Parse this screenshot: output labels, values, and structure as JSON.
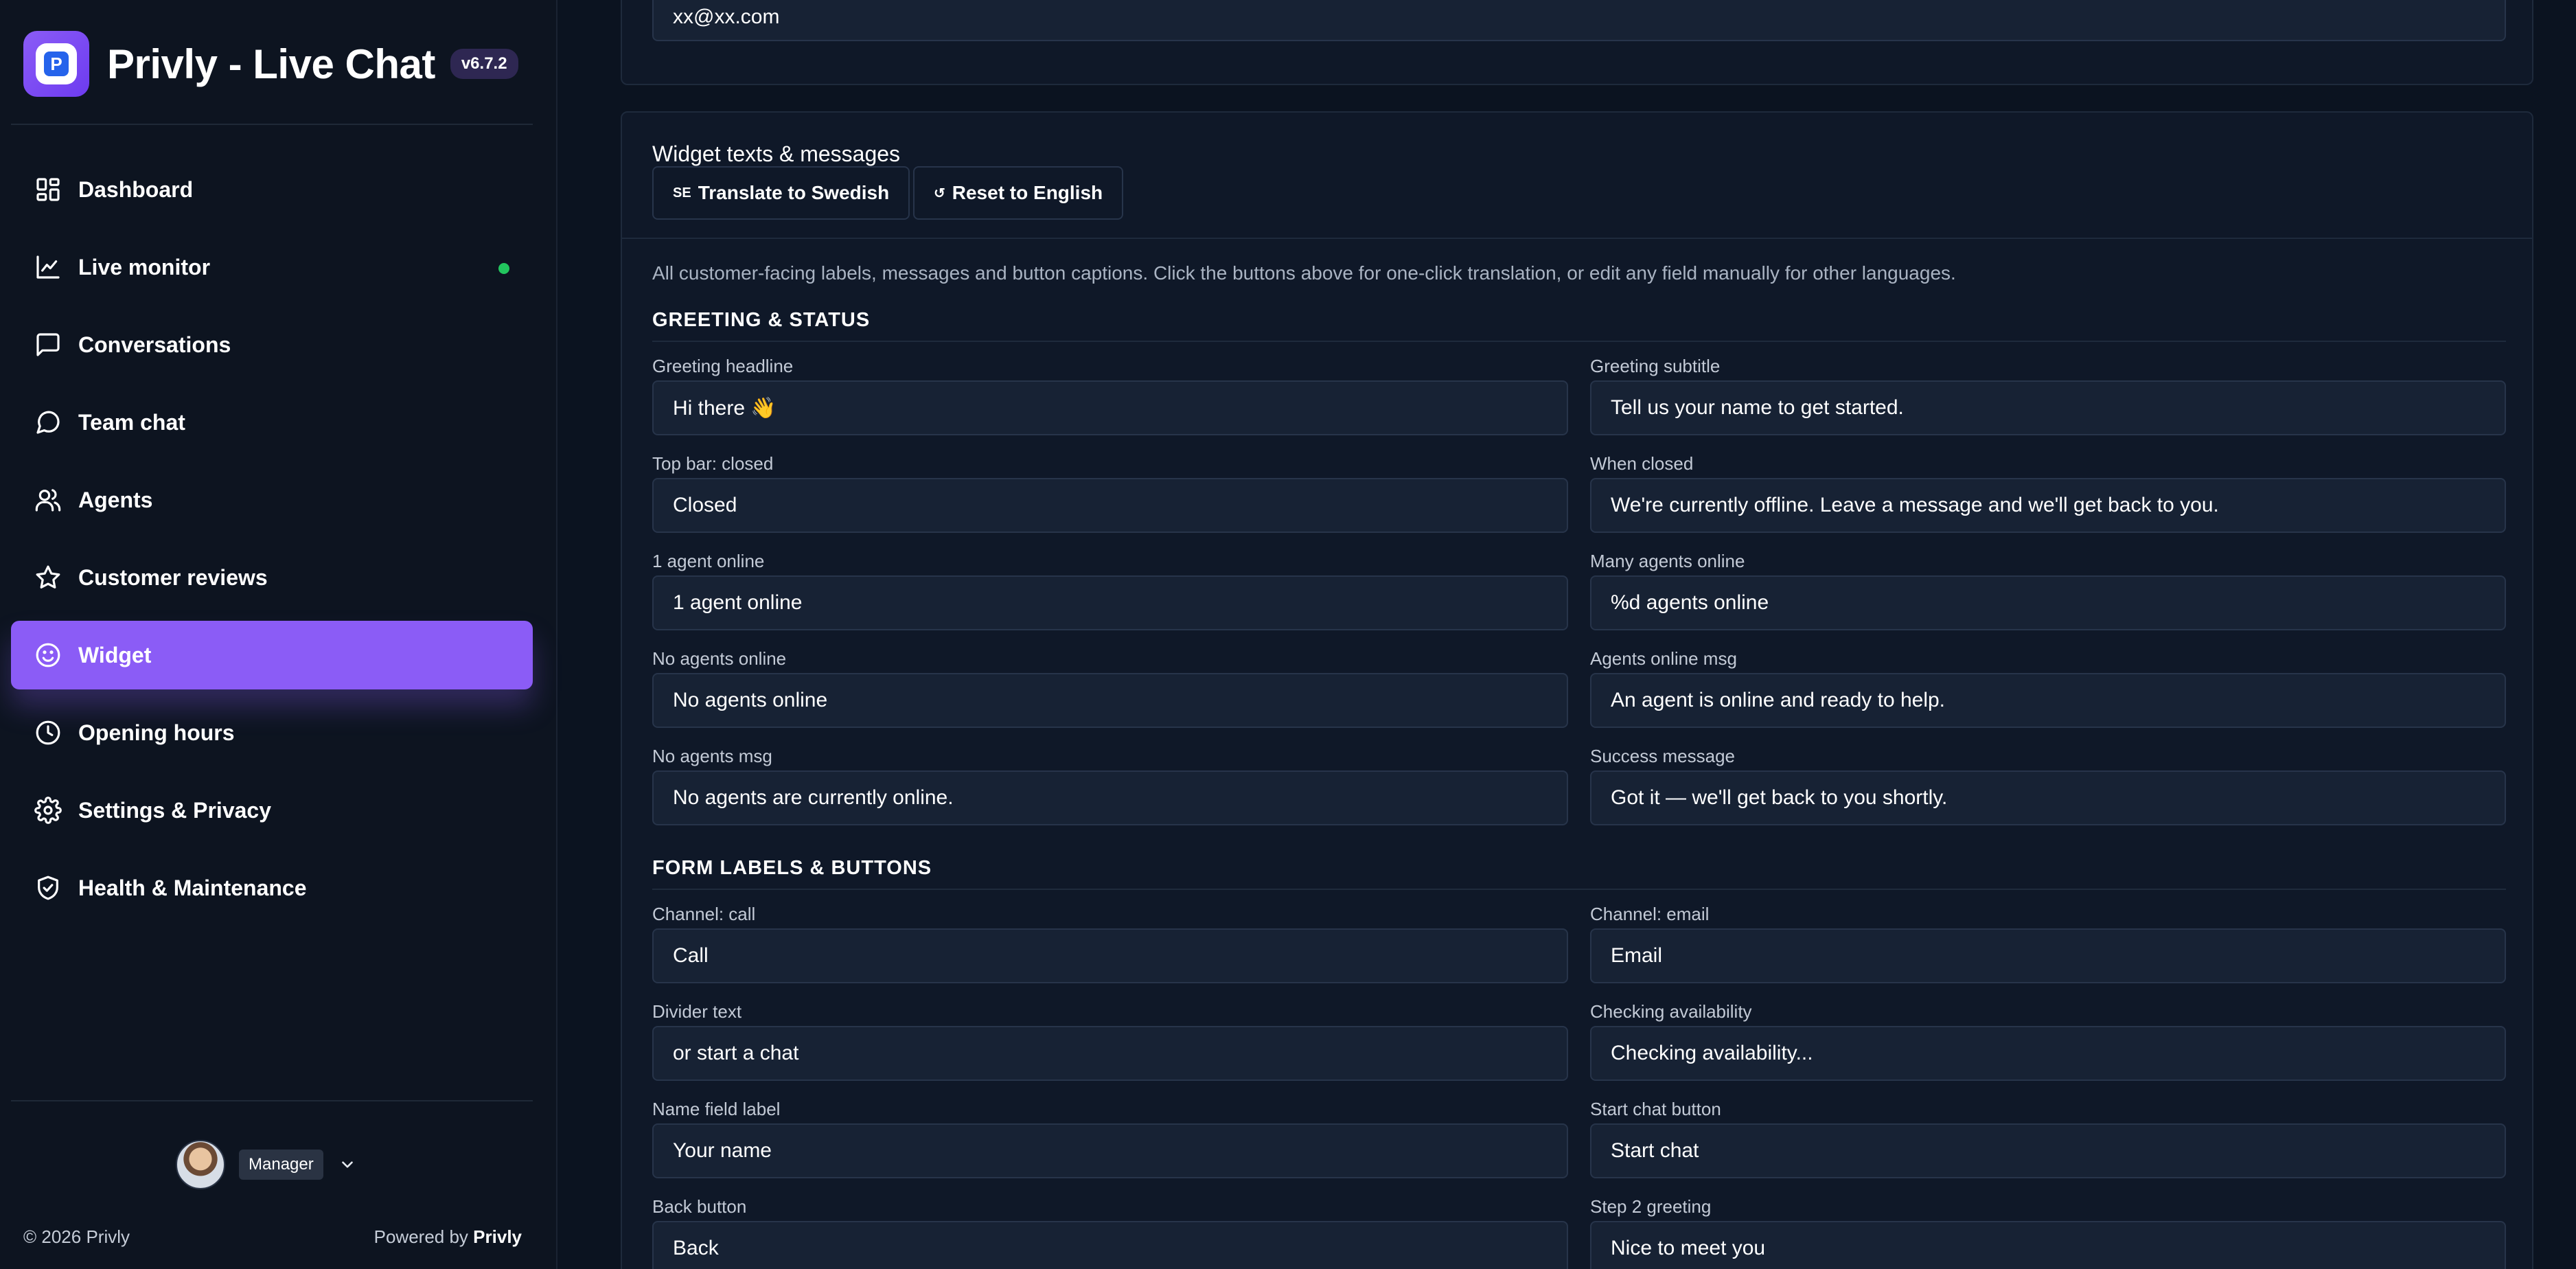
{
  "brand": {
    "title": "Privly - Live Chat",
    "version": "v6.7.2",
    "logo_letter": "P"
  },
  "nav": [
    {
      "label": "Dashboard",
      "icon": "dashboard-icon",
      "live": false,
      "active": false
    },
    {
      "label": "Live monitor",
      "icon": "chart-line-icon",
      "live": true,
      "active": false
    },
    {
      "label": "Conversations",
      "icon": "chat-square-icon",
      "live": false,
      "active": false
    },
    {
      "label": "Team chat",
      "icon": "chat-bubble-icon",
      "live": false,
      "active": false
    },
    {
      "label": "Agents",
      "icon": "users-icon",
      "live": false,
      "active": false
    },
    {
      "label": "Customer reviews",
      "icon": "star-icon",
      "live": false,
      "active": false
    },
    {
      "label": "Widget",
      "icon": "smiley-icon",
      "live": false,
      "active": true
    },
    {
      "label": "Opening hours",
      "icon": "clock-icon",
      "live": false,
      "active": false
    },
    {
      "label": "Settings & Privacy",
      "icon": "gear-icon",
      "live": false,
      "active": false
    },
    {
      "label": "Health & Maintenance",
      "icon": "shield-check-icon",
      "live": false,
      "active": false
    }
  ],
  "user": {
    "role": "Manager"
  },
  "footer": {
    "copyright": "© 2026 Privly",
    "powered_prefix": "Powered by",
    "powered_brand": "Privly"
  },
  "top_card": {
    "email_value": "xx@xx.com"
  },
  "widget": {
    "title": "Widget texts & messages",
    "translate_prefix": "SE",
    "translate_label": "Translate to Swedish",
    "reset_prefix": "↺",
    "reset_label": "Reset to English",
    "description": "All customer-facing labels, messages and button captions. Click the buttons above for one-click translation, or edit any field manually for other languages.",
    "groups": [
      {
        "title": "GREETING & STATUS",
        "fields": [
          {
            "label": "Greeting headline",
            "value": "Hi there 👋"
          },
          {
            "label": "Greeting subtitle",
            "value": "Tell us your name to get started."
          },
          {
            "label": "Top bar: closed",
            "value": "Closed"
          },
          {
            "label": "When closed",
            "value": "We're currently offline. Leave a message and we'll get back to you."
          },
          {
            "label": "1 agent online",
            "value": "1 agent online"
          },
          {
            "label": "Many agents online",
            "value": "%d agents online"
          },
          {
            "label": "No agents online",
            "value": "No agents online"
          },
          {
            "label": "Agents online msg",
            "value": "An agent is online and ready to help."
          },
          {
            "label": "No agents msg",
            "value": "No agents are currently online."
          },
          {
            "label": "Success message",
            "value": "Got it — we'll get back to you shortly."
          }
        ]
      },
      {
        "title": "FORM LABELS & BUTTONS",
        "fields": [
          {
            "label": "Channel: call",
            "value": "Call"
          },
          {
            "label": "Channel: email",
            "value": "Email"
          },
          {
            "label": "Divider text",
            "value": "or start a chat"
          },
          {
            "label": "Checking availability",
            "value": "Checking availability..."
          },
          {
            "label": "Name field label",
            "value": "Your name"
          },
          {
            "label": "Start chat button",
            "value": "Start chat"
          },
          {
            "label": "Back button",
            "value": "Back"
          },
          {
            "label": "Step 2 greeting",
            "value": "Nice to meet you"
          }
        ]
      }
    ]
  }
}
